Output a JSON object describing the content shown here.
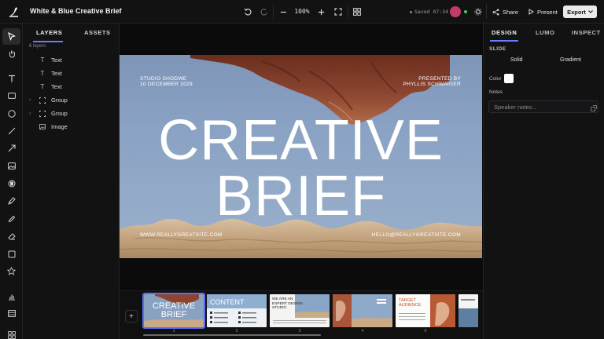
{
  "app": {
    "document_title": "White & Blue Creative Brief",
    "zoom_level": "100%",
    "saved_status": "Saved 07:34",
    "share_label": "Share",
    "present_label": "Present",
    "export_label": "Export",
    "avatar_color": "#c43a6a",
    "online_color": "#3ecf6b",
    "accent_color": "#5b6cf5"
  },
  "tools": [
    "select-icon",
    "hand-icon",
    "text-icon",
    "rectangle-icon",
    "ellipse-icon",
    "line-icon",
    "arrow-icon",
    "image-icon",
    "video-icon",
    "pen-icon",
    "pencil-icon",
    "eraser-icon",
    "frame-icon",
    "star-icon",
    "chart-icon",
    "table-icon",
    "grid-icon"
  ],
  "layers_panel": {
    "tabs": [
      "LAYERS",
      "ASSETS"
    ],
    "count": "6 layers",
    "items": [
      {
        "name": "Text",
        "icon": "text-icon",
        "expandable": false
      },
      {
        "name": "Text",
        "icon": "text-icon",
        "expandable": false
      },
      {
        "name": "Text",
        "icon": "text-icon",
        "expandable": false
      },
      {
        "name": "Group",
        "icon": "group-icon",
        "expandable": true
      },
      {
        "name": "Group",
        "icon": "group-icon",
        "expandable": true
      },
      {
        "name": "Image",
        "icon": "image-icon",
        "expandable": false
      }
    ]
  },
  "slide": {
    "studio_name": "STUDIO SHODWE",
    "date": "10 DECEMBER 2029",
    "presented_by": "PRESENTED BY",
    "presenter": "PHYLLIS SCHWAIGER",
    "title_line1": "CREATIVE",
    "title_line2": "BRIEF",
    "website": "WWW.REALLYGREATSITE.COM",
    "email": "HELLO@REALLYGREATSITE.COM"
  },
  "filmstrip": {
    "slides": [
      {
        "number": "1",
        "title": "CREATIVE BRIEF",
        "selected": true
      },
      {
        "number": "2",
        "title": "CONTENT",
        "selected": false
      },
      {
        "number": "3",
        "title": "WE ARE AN EXPERT DESIGN STUDIO",
        "selected": false
      },
      {
        "number": "4",
        "title": "",
        "selected": false
      },
      {
        "number": "5",
        "title": "TARGET AUDIENCE",
        "selected": false
      }
    ]
  },
  "right_panel": {
    "tabs": [
      "DESIGN",
      "LUMO",
      "INSPECT"
    ],
    "section": "SLIDE",
    "fill_options": [
      "Solid",
      "Gradient"
    ],
    "color_label": "Color",
    "color_value": "#ffffff",
    "notes_label": "Notes",
    "notes_placeholder": "Speaker notes..."
  }
}
